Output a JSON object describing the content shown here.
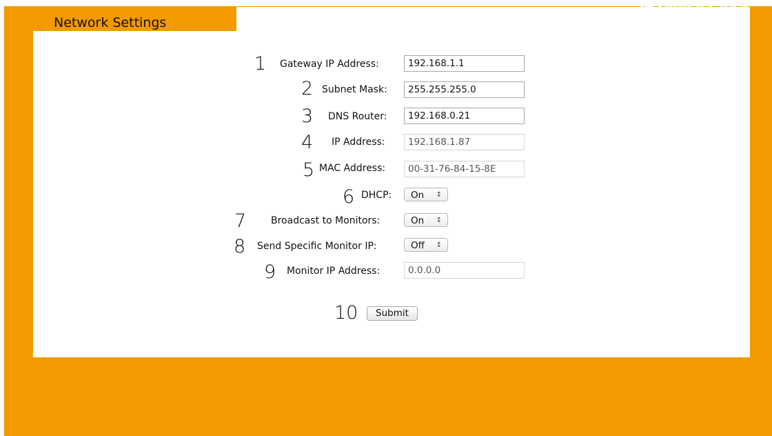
{
  "app_title": "IP Digital Clock",
  "page_tab": "Network Settings",
  "form": {
    "gateway": {
      "number": "1",
      "label": "Gateway IP Address:",
      "value": "192.168.1.1"
    },
    "subnet": {
      "number": "2",
      "label": "Subnet Mask:",
      "value": "255.255.255.0"
    },
    "dns": {
      "number": "3",
      "label": "DNS Router:",
      "value": "192.168.0.21"
    },
    "ip": {
      "number": "4",
      "label": "IP Address:",
      "value": "192.168.1.87"
    },
    "mac": {
      "number": "5",
      "label": "MAC Address:",
      "value": "00-31-76-84-15-8E"
    },
    "dhcp": {
      "number": "6",
      "label": "DHCP:",
      "value": "On"
    },
    "broadcast": {
      "number": "7",
      "label": "Broadcast to Monitors:",
      "value": "On"
    },
    "send_specific": {
      "number": "8",
      "label": "Send Specific Monitor IP:",
      "value": "Off"
    },
    "monitor_ip": {
      "number": "9",
      "label": "Monitor IP Address:",
      "value": "0.0.0.0"
    },
    "submit": {
      "number": "10",
      "label": "Submit"
    }
  },
  "icons": {
    "select_arrows": "up-down-arrows-icon"
  },
  "colors": {
    "frame": "#f39a00",
    "panel": "#ffffff"
  }
}
